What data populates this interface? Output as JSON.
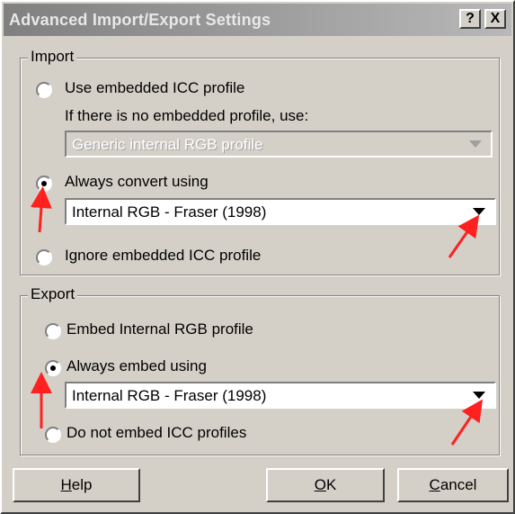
{
  "window": {
    "title": "Advanced Import/Export Settings",
    "help_button": "?",
    "close_button": "X"
  },
  "import": {
    "legend": "Import",
    "use_embedded_label": "Use embedded ICC profile",
    "no_embedded_hint": "If there is no embedded profile, use:",
    "fallback_profile": "Generic internal RGB profile",
    "always_convert_label": "Always convert using",
    "convert_profile": "Internal RGB - Fraser (1998)",
    "ignore_label": "Ignore embedded ICC profile",
    "selected": "always_convert"
  },
  "export": {
    "legend": "Export",
    "embed_internal_label": "Embed Internal RGB profile",
    "always_embed_label": "Always embed using",
    "embed_profile": "Internal RGB - Fraser (1998)",
    "no_embed_label": "Do not embed ICC profiles",
    "selected": "always_embed"
  },
  "buttons": {
    "help": {
      "mnemonic": "H",
      "rest": "elp"
    },
    "ok": {
      "mnemonic": "O",
      "rest": "K"
    },
    "cancel": {
      "mnemonic": "C",
      "rest": "ancel"
    }
  },
  "colors": {
    "annotation_arrow": "#ff2020",
    "dialog_face": "#d4d0c8"
  }
}
